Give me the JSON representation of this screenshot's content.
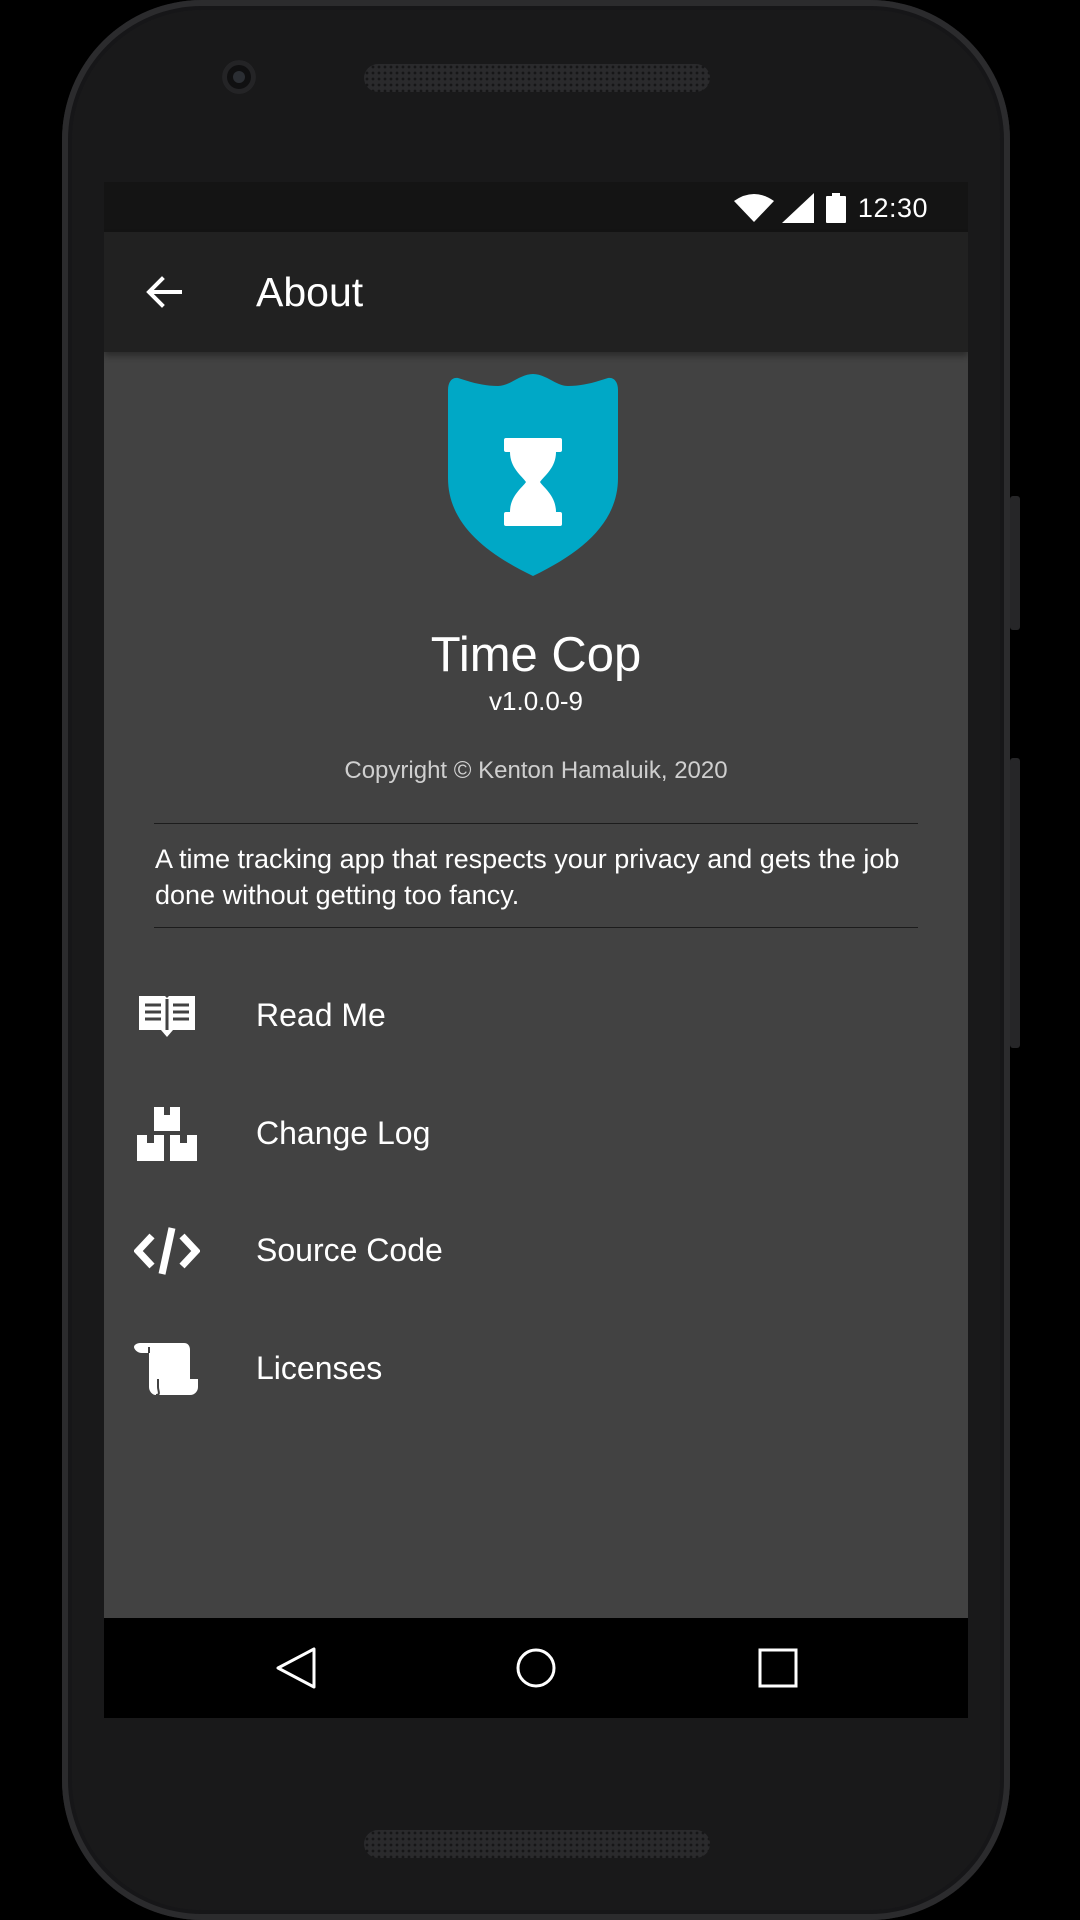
{
  "status_bar": {
    "time": "12:30",
    "icons": [
      "wifi-icon",
      "cell-signal-icon",
      "battery-icon"
    ]
  },
  "app_bar": {
    "back_icon": "arrow-back-icon",
    "title": "About"
  },
  "about": {
    "logo_icon": "shield-hourglass-logo",
    "app_name": "Time Cop",
    "version": "v1.0.0-9",
    "copyright": "Copyright © Kenton Hamaluik, 2020",
    "description": "A time tracking app that respects your privacy and gets the job done without getting too fancy."
  },
  "menu": {
    "items": [
      {
        "label": "Read Me",
        "icon": "book-open-icon"
      },
      {
        "label": "Change Log",
        "icon": "boxes-icon"
      },
      {
        "label": "Source Code",
        "icon": "code-icon"
      },
      {
        "label": "Licenses",
        "icon": "scroll-icon"
      }
    ]
  },
  "nav_bar": {
    "icons": [
      "nav-back-icon",
      "nav-home-icon",
      "nav-recents-icon"
    ]
  },
  "colors": {
    "accent": "#00a8c6",
    "background": "#424242",
    "app_bar": "#212121",
    "text": "#ffffff"
  }
}
